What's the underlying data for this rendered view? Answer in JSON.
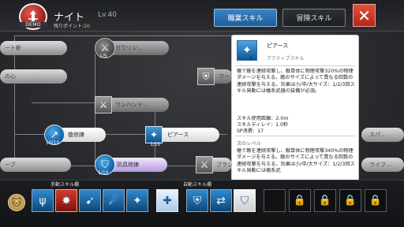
{
  "header": {
    "class_name": "ナイト",
    "level": "Lv.40",
    "demo_label": "DEMO",
    "points_label": "残りポイント:",
    "points_value": "10",
    "tab_active": "職業スキル",
    "tab_inactive": "冒険スキル",
    "close_label": "✕"
  },
  "tree": {
    "nodes": [
      {
        "label": "ート斬",
        "level": ""
      },
      {
        "label": "ガウリン...",
        "level": "1/5"
      },
      {
        "label": "の心",
        "level": ""
      },
      {
        "label": "ワーン...",
        "level": ""
      },
      {
        "label": "ワンハンド...",
        "level": ""
      },
      {
        "label": "槍修練",
        "level": "10/10"
      },
      {
        "label": "ピアース",
        "level": "1/10"
      },
      {
        "label": "スパ...",
        "level": ""
      },
      {
        "label": "ーブ",
        "level": ""
      },
      {
        "label": "防具修練",
        "level": "1/10"
      },
      {
        "label": "ブラン...",
        "level": ""
      },
      {
        "label": "ライフ...",
        "level": ""
      }
    ]
  },
  "popup": {
    "skill_name": "ピアース",
    "skill_level": "1",
    "skill_type": "アクティブスキル",
    "description": "槍で敵を連続攻撃し、敵単体に物理攻撃320%の物理ダメージを与える。敵のサイズによって異なる回数の連続攻撃を与える。効果は小/中/大サイズ：1/2/3回スキル発動には槍系武器の装備が必須。",
    "stat_range": "スキル使用距離：2.0m",
    "stat_delay": "スキルディレイ：1.0秒",
    "stat_sp": "SP消費：17",
    "next_label": "次のレベル",
    "next_description": "槍で敵を連続攻撃し、敵単体に物理攻撃340%の物理ダメージを与える。敵のサイズによって異なる回数の連続攻撃を与える。効果は小/中/大サイズ：1/2/3回スキル発動には槍系武"
  },
  "bottom": {
    "manual_label": "手動スキル欄",
    "auto_label": "自動スキル欄",
    "manual_slots": [
      "spear-icon",
      "red-skill-icon",
      "thrust-icon",
      "charge-icon",
      "pierce-icon",
      "cross-icon",
      "knight-icon"
    ],
    "auto_slots": [
      "shield-icon",
      "swap-icon",
      "guard-icon",
      "magic-circle-icon",
      "empty",
      "lock-icon",
      "lock-icon",
      "lock-icon",
      "lock-icon"
    ]
  },
  "colors": {
    "accent_blue": "#1e5c97",
    "close_red": "#b42818",
    "points_gold": "#e3c25e"
  }
}
